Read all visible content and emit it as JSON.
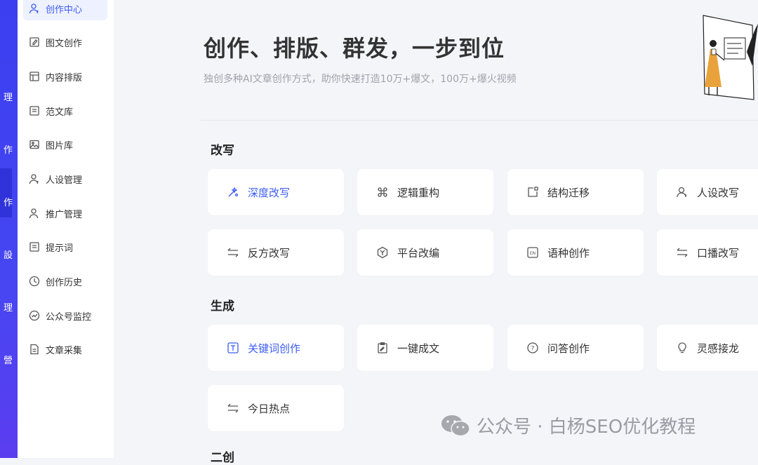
{
  "rail": {
    "items": [
      "理",
      "作",
      "作",
      "設",
      "理",
      "營"
    ]
  },
  "sidebar": {
    "items": [
      {
        "label": "创作中心",
        "icon": "user-icon"
      },
      {
        "label": "图文创作",
        "icon": "edit-icon"
      },
      {
        "label": "内容排版",
        "icon": "layout-icon"
      },
      {
        "label": "范文库",
        "icon": "document-icon"
      },
      {
        "label": "图片库",
        "icon": "image-icon"
      },
      {
        "label": "人设管理",
        "icon": "user-icon"
      },
      {
        "label": "推广管理",
        "icon": "user-icon"
      },
      {
        "label": "提示词",
        "icon": "document-icon"
      },
      {
        "label": "创作历史",
        "icon": "clock-icon"
      },
      {
        "label": "公众号监控",
        "icon": "trend-icon"
      },
      {
        "label": "文章采集",
        "icon": "file-icon"
      }
    ]
  },
  "hero": {
    "title": "创作、排版、群发，一步到位",
    "subtitle": "独创多种AI文章创作方式，助你快速打造10万+爆文，100万+爆火视频"
  },
  "sections": {
    "rewrite": {
      "title": "改写",
      "cards": [
        {
          "label": "深度改写",
          "icon": "magic-wand-icon"
        },
        {
          "label": "逻辑重构",
          "icon": "command-icon"
        },
        {
          "label": "结构迁移",
          "icon": "structure-icon"
        },
        {
          "label": "人设改写",
          "icon": "user-icon"
        },
        {
          "label": "反方改写",
          "icon": "swap-icon"
        },
        {
          "label": "平台改编",
          "icon": "hexagon-icon"
        },
        {
          "label": "语种创作",
          "icon": "language-icon"
        },
        {
          "label": "口播改写",
          "icon": "swap-icon"
        }
      ]
    },
    "generate": {
      "title": "生成",
      "cards": [
        {
          "label": "关键词创作",
          "icon": "text-icon"
        },
        {
          "label": "一键成文",
          "icon": "clipboard-icon"
        },
        {
          "label": "问答创作",
          "icon": "question-icon"
        },
        {
          "label": "灵感接龙",
          "icon": "bulb-icon"
        },
        {
          "label": "今日热点",
          "icon": "swap-icon"
        }
      ]
    },
    "next": {
      "title": "二创"
    }
  },
  "watermark": {
    "text": "公众号 · 白杨SEO优化教程"
  },
  "colors": {
    "accent": "#3d5cf5",
    "rail": "#4646f2",
    "background": "#f4f5f9"
  }
}
